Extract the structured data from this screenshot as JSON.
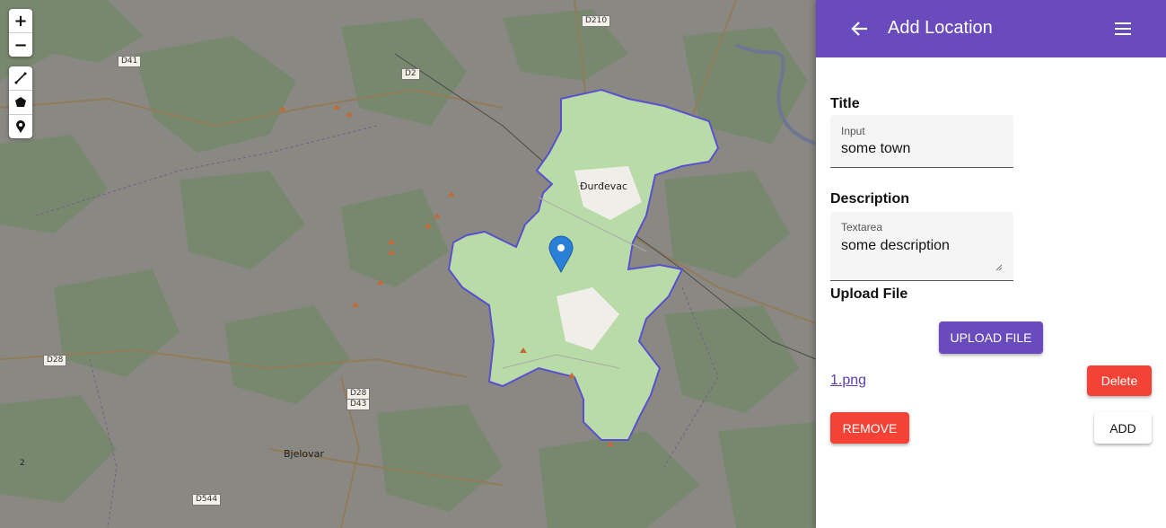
{
  "map": {
    "roads": [
      "D210",
      "D41",
      "D2",
      "D28",
      "D28",
      "D43",
      "D544",
      "2"
    ],
    "places": [
      "Đurđevac",
      "Bjelovar"
    ],
    "controls": {
      "zoom_in": "+",
      "zoom_out": "−",
      "draw_tools": [
        "polyline-icon",
        "polygon-icon",
        "marker-icon"
      ]
    }
  },
  "colors": {
    "accent": "#6a4bbd",
    "danger": "#f44336",
    "region_fill": "#b9dba8",
    "region_border": "#5a4fcf",
    "marker": "#2a7fd6"
  },
  "header": {
    "title": "Add Location",
    "back_icon": "arrow-left-icon",
    "menu_icon": "hamburger-menu-icon"
  },
  "form": {
    "title_section": "Title",
    "title_field": {
      "label": "Input",
      "value": "some town"
    },
    "description_section": "Description",
    "description_field": {
      "label": "Textarea",
      "value": "some description"
    },
    "upload_section": "Upload File",
    "upload_button": "UPLOAD FILE",
    "file_name": "1.png",
    "delete_button": "Delete",
    "remove_button": "REMOVE",
    "add_button": "ADD"
  }
}
